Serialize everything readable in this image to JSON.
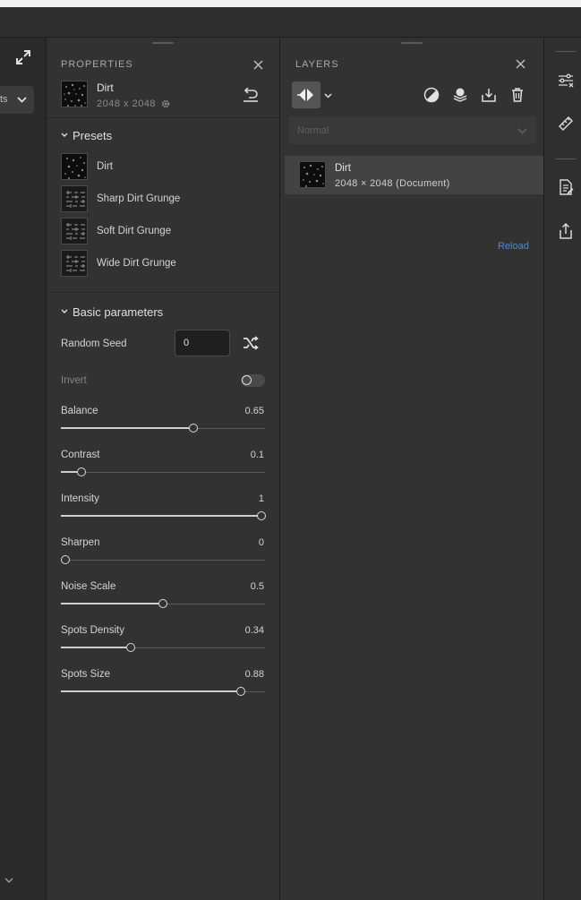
{
  "left_panel": {
    "dropdown_label": "ts"
  },
  "properties": {
    "title": "PROPERTIES",
    "document": {
      "name": "Dirt",
      "size": "2048 x 2048"
    },
    "presets": {
      "header": "Presets",
      "items": [
        {
          "label": "Dirt",
          "thumb": "dirt"
        },
        {
          "label": "Sharp Dirt Grunge",
          "thumb": "grunge"
        },
        {
          "label": "Soft Dirt Grunge",
          "thumb": "grunge"
        },
        {
          "label": "Wide Dirt Grunge",
          "thumb": "grunge"
        }
      ]
    },
    "basic": {
      "header": "Basic parameters",
      "random_seed": {
        "label": "Random Seed",
        "value": "0"
      },
      "invert": {
        "label": "Invert",
        "enabled": false
      },
      "sliders": [
        {
          "label": "Balance",
          "value": "0.65",
          "fraction": 0.65
        },
        {
          "label": "Contrast",
          "value": "0.1",
          "fraction": 0.1
        },
        {
          "label": "Intensity",
          "value": "1",
          "fraction": 1.0
        },
        {
          "label": "Sharpen",
          "value": "0",
          "fraction": 0.0
        },
        {
          "label": "Noise Scale",
          "value": "0.5",
          "fraction": 0.5
        },
        {
          "label": "Spots Density",
          "value": "0.34",
          "fraction": 0.34
        },
        {
          "label": "Spots Size",
          "value": "0.88",
          "fraction": 0.88
        }
      ]
    }
  },
  "layers": {
    "title": "LAYERS",
    "blend_mode": "Normal",
    "items": [
      {
        "name": "Dirt",
        "detail": "2048 × 2048 (Document)"
      }
    ],
    "reload_label": "Reload"
  },
  "right_toolbar": {
    "icons": [
      "adjust-icon",
      "ruler-icon",
      "document-edit-icon",
      "export-icon"
    ]
  },
  "colors": {
    "accent": "#3b8ee6",
    "panel_bg": "#323232"
  }
}
